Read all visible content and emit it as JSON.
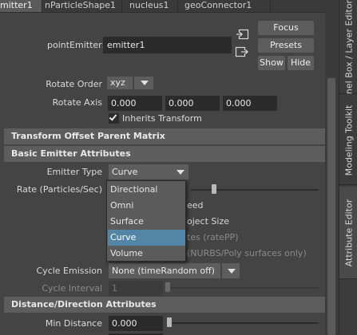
{
  "tabs": [
    {
      "label": "mitter1",
      "active": true
    },
    {
      "label": "nParticleShape1",
      "active": false
    },
    {
      "label": "nucleus1",
      "active": false
    },
    {
      "label": "geoConnector1",
      "active": false
    }
  ],
  "side_tabs": {
    "channel_box": "nel Box / Layer Editor",
    "modeling_toolkit": "Modeling Toolkit",
    "attribute_editor": "Attribute Editor"
  },
  "header": {
    "node_type_label": "pointEmitter:",
    "node_name": "emitter1",
    "focus_label": "Focus",
    "presets_label": "Presets",
    "show_label": "Show",
    "hide_label": "Hide"
  },
  "attributes": {
    "rotate_order_label": "Rotate Order",
    "rotate_order_value": "xyz",
    "rotate_axis_label": "Rotate Axis",
    "rotate_axis_x": "0.000",
    "rotate_axis_y": "0.000",
    "rotate_axis_z": "0.000",
    "inherits_transform_label": "Inherits Transform",
    "inherits_transform_checked": true,
    "section_transform_offset": "Transform Offset Parent Matrix",
    "section_basic_emitter": "Basic Emitter Attributes",
    "emitter_type_label": "Emitter Type",
    "emitter_type_value": "Curve",
    "rate_label": "Rate (Particles/Sec)",
    "rate_slider_fraction": 0.18,
    "partial_text_1": "eed",
    "partial_text_2": "oject Size",
    "partial_text_3": "tes (ratePP)",
    "partial_text_4": "(NURBS/Poly surfaces only)",
    "cycle_emission_label": "Cycle Emission",
    "cycle_emission_value": "None (timeRandom off)",
    "cycle_interval_label": "Cycle Interval",
    "cycle_interval_value": "1",
    "section_distance_direction": "Distance/Direction Attributes",
    "min_distance_label": "Min Distance",
    "min_distance_value": "0.000"
  },
  "emitter_type_options": [
    "Directional",
    "Omni",
    "Surface",
    "Curve",
    "Volume"
  ],
  "emitter_type_selected_index": 3,
  "colors": {
    "selection": "#5285a6",
    "background": "#444444",
    "section_header": "#5d5d5d",
    "field": "#2b2b2b"
  },
  "icons": [
    "select-input-icon",
    "select-output-icon",
    "checkmark-icon",
    "dropdown-arrow-icon"
  ]
}
